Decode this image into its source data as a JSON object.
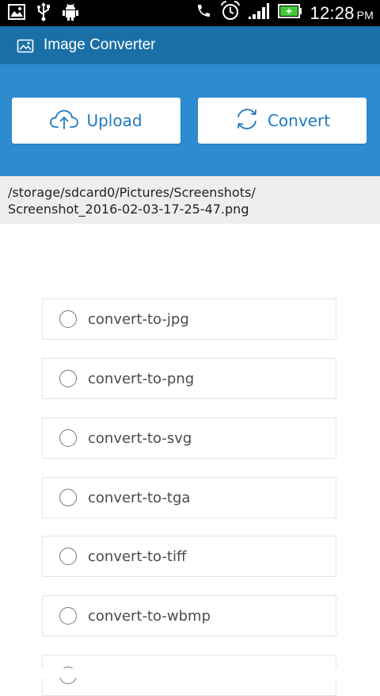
{
  "status_bar": {
    "time": "12:28",
    "ampm": "PM",
    "icons": [
      "gallery-notification-icon",
      "usb-icon",
      "android-debug-icon",
      "mute-icon",
      "alarm-icon",
      "signal-icon",
      "battery-charging-icon"
    ]
  },
  "app_bar": {
    "title": "Image Converter",
    "icon": "image-icon"
  },
  "actions": {
    "upload_label": "Upload",
    "convert_label": "Convert"
  },
  "file_path": {
    "line1": "/storage/sdcard0/Pictures/Screenshots/",
    "line2": "Screenshot_2016-02-03-17-25-47.png"
  },
  "options": [
    {
      "label": "convert-to-jpg"
    },
    {
      "label": "convert-to-png"
    },
    {
      "label": "convert-to-svg"
    },
    {
      "label": "convert-to-tga"
    },
    {
      "label": "convert-to-tiff"
    },
    {
      "label": "convert-to-wbmp"
    },
    {
      "label": ""
    }
  ],
  "colors": {
    "status_bar": "#000000",
    "app_bar": "#1a6fa7",
    "action_panel": "#2d8bd0",
    "accent_text": "#1f7ac0",
    "path_bar": "#eeeeee"
  }
}
